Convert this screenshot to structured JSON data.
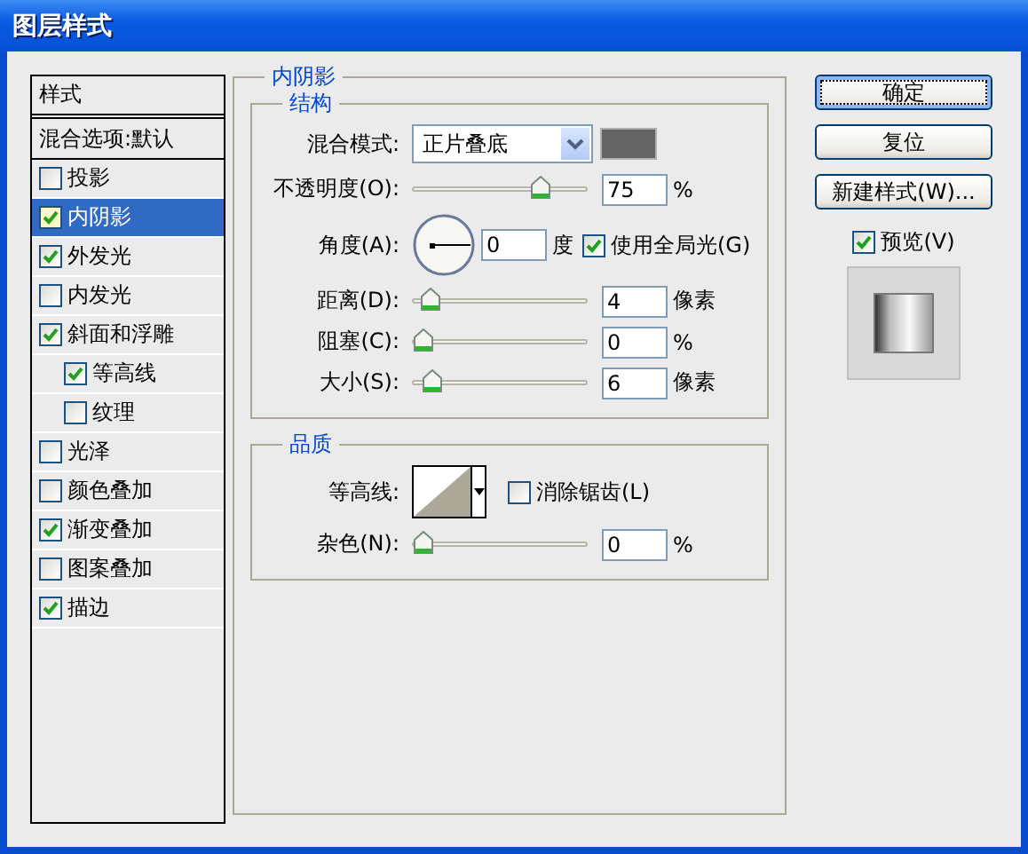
{
  "window": {
    "title": "图层样式"
  },
  "sidebar": {
    "items": [
      {
        "kind": "header",
        "label": "样式",
        "selected": false
      },
      {
        "kind": "option",
        "label": "混合选项:默认",
        "selected": false
      },
      {
        "kind": "check",
        "label": "投影",
        "checked": false,
        "selected": false
      },
      {
        "kind": "check",
        "label": "内阴影",
        "checked": true,
        "selected": true
      },
      {
        "kind": "check",
        "label": "外发光",
        "checked": true,
        "selected": false
      },
      {
        "kind": "check",
        "label": "内发光",
        "checked": false,
        "selected": false
      },
      {
        "kind": "check",
        "label": "斜面和浮雕",
        "checked": true,
        "selected": false,
        "children": [
          {
            "kind": "check",
            "label": "等高线",
            "checked": true,
            "selected": false
          },
          {
            "kind": "check",
            "label": "纹理",
            "checked": false,
            "selected": false
          }
        ]
      },
      {
        "kind": "check",
        "label": "光泽",
        "checked": false,
        "selected": false
      },
      {
        "kind": "check",
        "label": "颜色叠加",
        "checked": false,
        "selected": false
      },
      {
        "kind": "check",
        "label": "渐变叠加",
        "checked": true,
        "selected": false
      },
      {
        "kind": "check",
        "label": "图案叠加",
        "checked": false,
        "selected": false
      },
      {
        "kind": "check",
        "label": "描边",
        "checked": true,
        "selected": false
      }
    ]
  },
  "panel": {
    "title": "内阴影",
    "structure": {
      "title": "结构",
      "rows": [
        {
          "kind": "select",
          "label": "混合模式:",
          "value": "正片叠底"
        },
        {
          "kind": "slider",
          "label": "不透明度(O):",
          "level": 0.75,
          "value": "75",
          "unit": "%"
        },
        {
          "kind": "angle",
          "label": "角度(A):",
          "value": "0",
          "unit": "度",
          "option": {
            "label": "使用全局光(G)",
            "checked": true
          }
        },
        {
          "kind": "slider",
          "label": "距离(D):",
          "level": 0.04,
          "value": "4",
          "unit": "像素"
        },
        {
          "kind": "slider",
          "label": "阻塞(C):",
          "level": 0,
          "value": "0",
          "unit": "%"
        },
        {
          "kind": "slider",
          "label": "大小(S):",
          "level": 0.06,
          "value": "6",
          "unit": "像素"
        }
      ]
    },
    "quality": {
      "title": "品质",
      "rows": [
        {
          "kind": "contour",
          "label": "等高线:",
          "option": {
            "label": "消除锯齿(L)",
            "checked": false
          }
        },
        {
          "kind": "slider",
          "label": "杂色(N):",
          "level": 0,
          "value": "0",
          "unit": "%"
        }
      ]
    }
  },
  "buttons": [
    {
      "label": "确定",
      "default": true
    },
    {
      "label": "复位",
      "default": false
    },
    {
      "label": "新建样式(W)...",
      "default": false
    }
  ],
  "preview": {
    "label": "预览(V)",
    "checked": true
  }
}
